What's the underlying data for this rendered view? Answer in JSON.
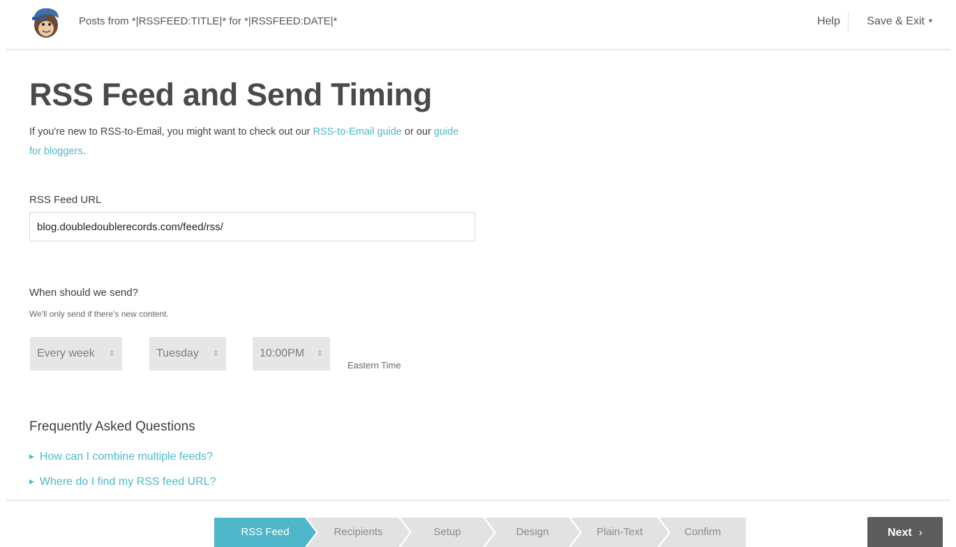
{
  "header": {
    "title": "Posts from *|RSSFEED:TITLE|* for *|RSSFEED:DATE|*",
    "help_label": "Help",
    "save_exit_label": "Save & Exit",
    "caret": "▾"
  },
  "main": {
    "page_title": "RSS Feed and Send Timing",
    "intro_before": "If you're new to RSS-to-Email, you might want to check out our ",
    "intro_link1": "RSS-to-Email guide",
    "intro_middle": " or our ",
    "intro_link2": "guide for bloggers",
    "intro_end": ".",
    "url_label": "RSS Feed URL",
    "url_value": "blog.doubledoublerecords.com/feed/rss/",
    "send_heading": "When should we send?",
    "send_sub": "We'll only send if there's new content.",
    "frequency": "Every week",
    "day": "Tuesday",
    "time": "10:00PM",
    "timezone": "Eastern Time",
    "select_arrows": "⇕",
    "faq_title": "Frequently Asked Questions",
    "faq_bullet": "▶",
    "faq": [
      "How can I combine multiple feeds?",
      "Where do I find my RSS feed URL?"
    ]
  },
  "footer": {
    "steps": [
      "RSS Feed",
      "Recipients",
      "Setup",
      "Design",
      "Plain-Text",
      "Confirm"
    ],
    "next_label": "Next",
    "next_chevron": "›"
  },
  "colors": {
    "accent": "#4fb7c9",
    "next_button": "#5c5c5c",
    "select_bg": "#e6e6e6"
  }
}
